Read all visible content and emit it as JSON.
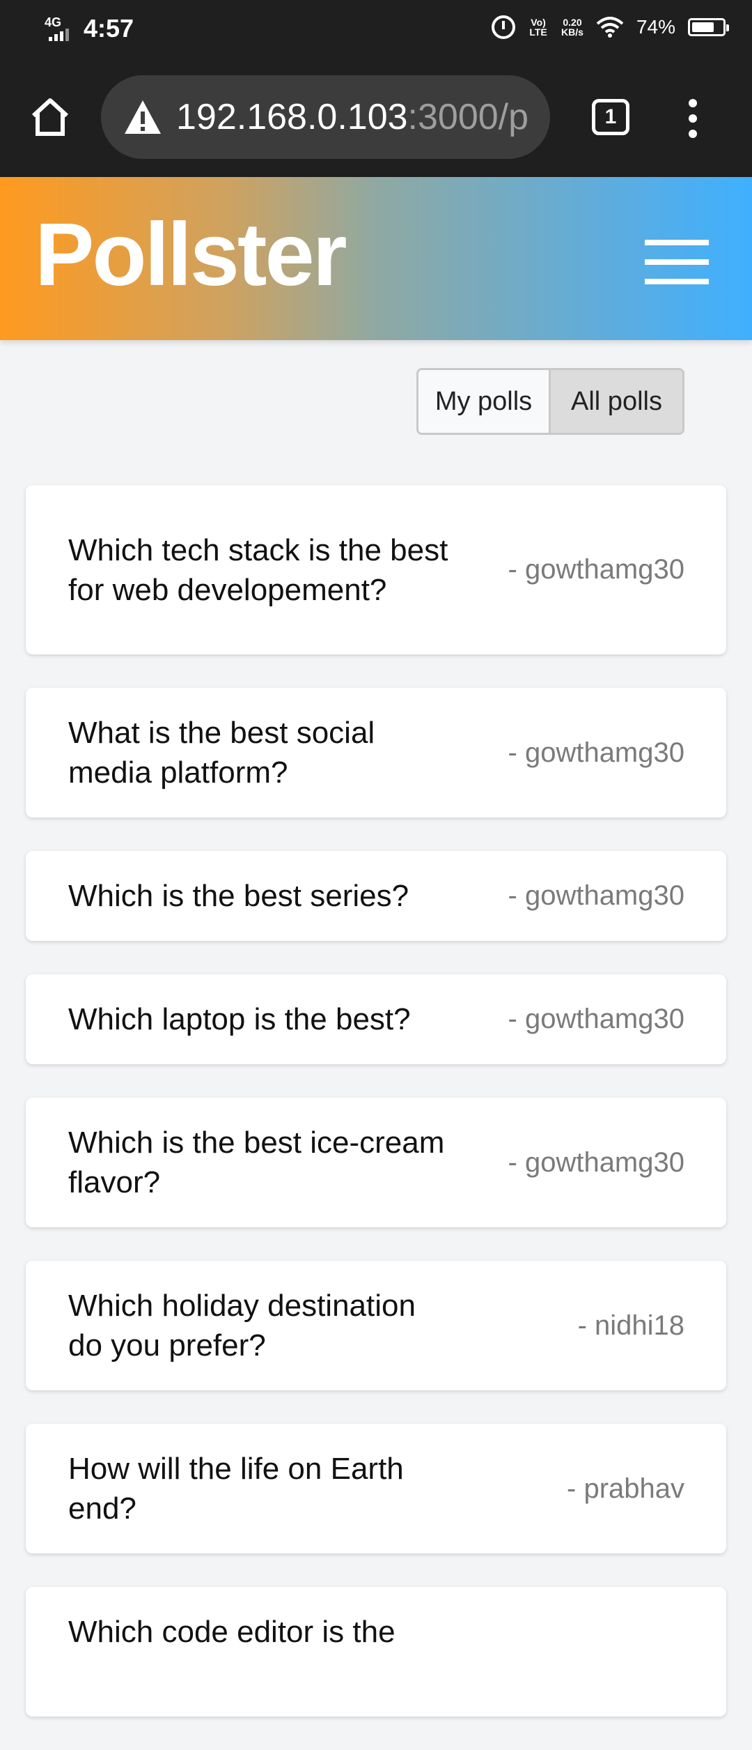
{
  "status_bar": {
    "network": "4G",
    "time": "4:57",
    "volte": "Vo) LTE",
    "speed_value": "0.20",
    "speed_unit": "KB/s",
    "battery_percent": "74%",
    "battery_level": 0.74
  },
  "browser": {
    "url_host": "192.168.0.103",
    "url_rest": ":3000/p",
    "tab_count": "1"
  },
  "header": {
    "brand": "Pollster"
  },
  "toggle": {
    "my_polls": "My polls",
    "all_polls": "All polls",
    "selected": "All polls"
  },
  "polls": [
    {
      "question": "Which tech stack is the best for web developement?",
      "author": "- gowthamg30"
    },
    {
      "question": "What is the best social media platform?",
      "author": "- gowthamg30"
    },
    {
      "question": "Which is the best series?",
      "author": "- gowthamg30"
    },
    {
      "question": "Which laptop is the best?",
      "author": "- gowthamg30"
    },
    {
      "question": "Which is the best ice-cream flavor?",
      "author": "- gowthamg30"
    },
    {
      "question": "Which holiday destination do you prefer?",
      "author": "- nidhi18"
    },
    {
      "question": "How will the life on Earth end?",
      "author": "- prabhav"
    },
    {
      "question": "Which code editor is the",
      "author": ""
    }
  ]
}
